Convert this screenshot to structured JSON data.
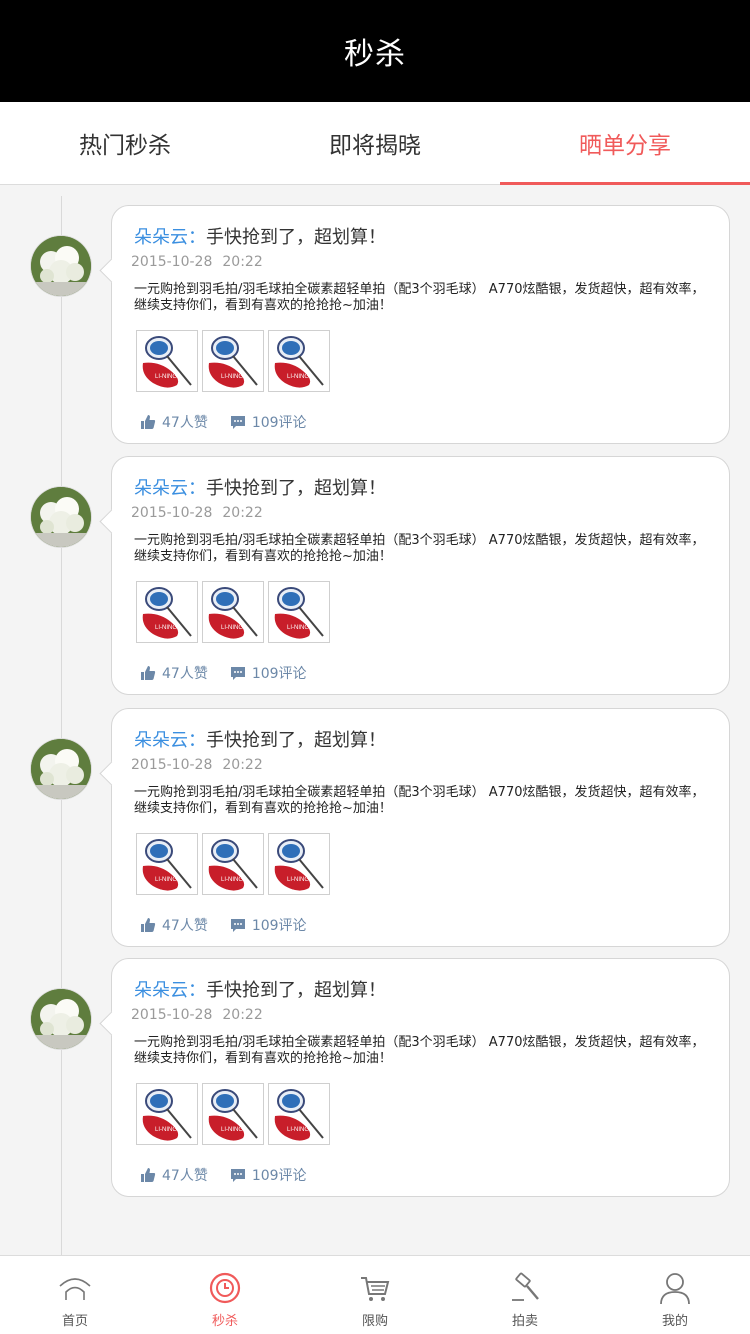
{
  "header": {
    "title": "秒杀"
  },
  "tabs": [
    {
      "label": "热门秒杀",
      "active": false
    },
    {
      "label": "即将揭晓",
      "active": false
    },
    {
      "label": "晒单分享",
      "active": true
    }
  ],
  "posts": [
    {
      "user": "朵朵云：",
      "headline": "手快抢到了，超划算！",
      "date": "2015-10-28",
      "time": "20:22",
      "description": "一元购抢到羽毛拍/羽毛球拍全碳素超轻单拍（配3个羽毛球） A770炫酷银，发货超快，超有效率，继续支持你们，看到有喜欢的抢抢抢~加油！",
      "likes": "47人赞",
      "comments": "109评论"
    },
    {
      "user": "朵朵云：",
      "headline": "手快抢到了，超划算！",
      "date": "2015-10-28",
      "time": "20:22",
      "description": "一元购抢到羽毛拍/羽毛球拍全碳素超轻单拍（配3个羽毛球） A770炫酷银，发货超快，超有效率，继续支持你们，看到有喜欢的抢抢抢~加油！",
      "likes": "47人赞",
      "comments": "109评论"
    },
    {
      "user": "朵朵云：",
      "headline": "手快抢到了，超划算！",
      "date": "2015-10-28",
      "time": "20:22",
      "description": "一元购抢到羽毛拍/羽毛球拍全碳素超轻单拍（配3个羽毛球） A770炫酷银，发货超快，超有效率，继续支持你们，看到有喜欢的抢抢抢~加油！",
      "likes": "47人赞",
      "comments": "109评论"
    },
    {
      "user": "朵朵云：",
      "headline": "手快抢到了，超划算！",
      "date": "2015-10-28",
      "time": "20:22",
      "description": "一元购抢到羽毛拍/羽毛球拍全碳素超轻单拍（配3个羽毛球） A770炫酷银，发货超快，超有效率，继续支持你们，看到有喜欢的抢抢抢~加油！",
      "likes": "47人赞",
      "comments": "109评论"
    }
  ],
  "bottom_nav": [
    {
      "label": "首页",
      "icon": "home-icon",
      "active": false
    },
    {
      "label": "秒杀",
      "icon": "clock-icon",
      "active": true
    },
    {
      "label": "限购",
      "icon": "cart-icon",
      "active": false
    },
    {
      "label": "拍卖",
      "icon": "gavel-icon",
      "active": false
    },
    {
      "label": "我的",
      "icon": "user-icon",
      "active": false
    }
  ],
  "colors": {
    "accent": "#f05a5a",
    "username": "#3b8fe0",
    "meta": "#6c88a8"
  }
}
